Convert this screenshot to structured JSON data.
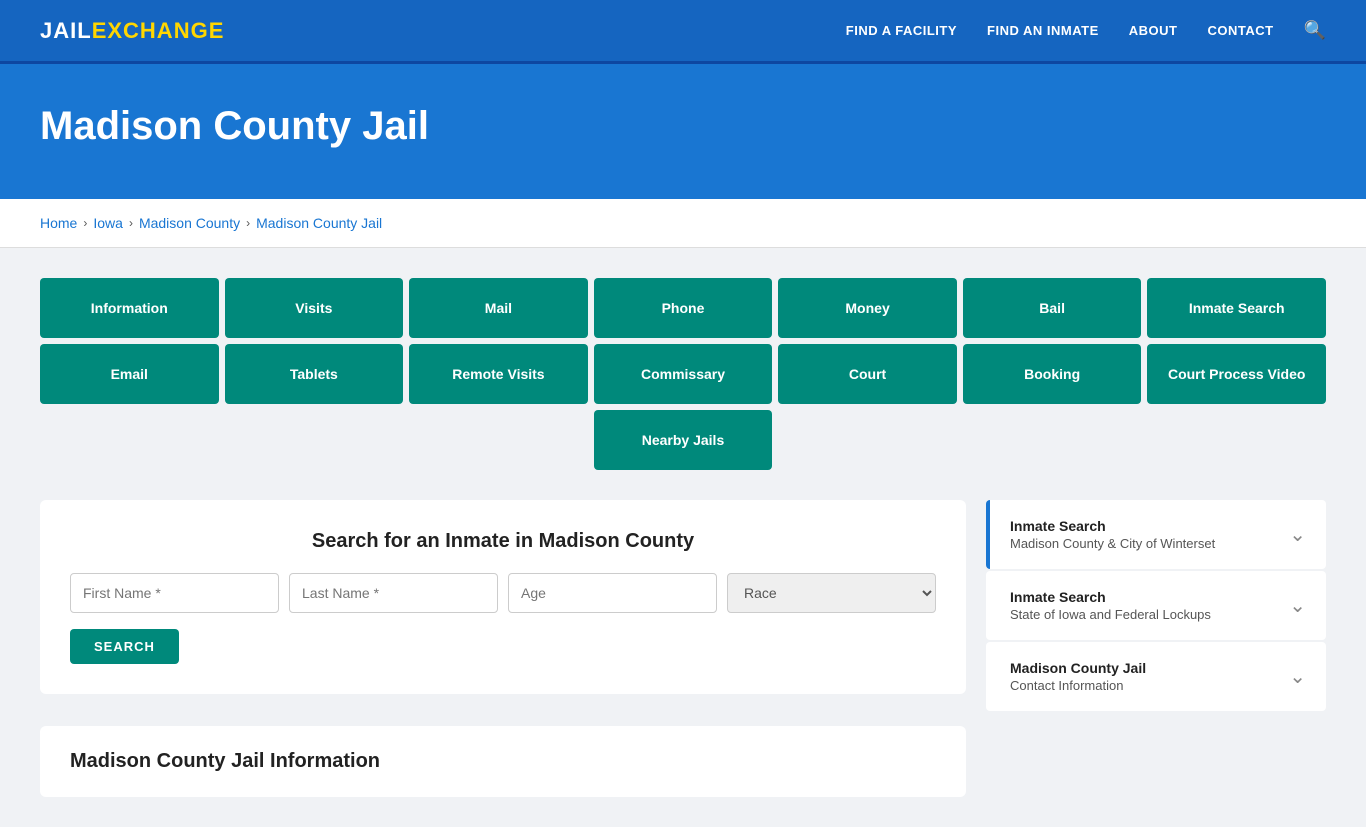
{
  "header": {
    "logo_jail": "JAIL",
    "logo_exchange": "EXCHANGE",
    "nav": [
      {
        "label": "FIND A FACILITY"
      },
      {
        "label": "FIND AN INMATE"
      },
      {
        "label": "ABOUT"
      },
      {
        "label": "CONTACT"
      }
    ]
  },
  "hero": {
    "title": "Madison County Jail"
  },
  "breadcrumb": {
    "items": [
      "Home",
      "Iowa",
      "Madison County",
      "Madison County Jail"
    ]
  },
  "tiles_row1": [
    {
      "label": "Information"
    },
    {
      "label": "Visits"
    },
    {
      "label": "Mail"
    },
    {
      "label": "Phone"
    },
    {
      "label": "Money"
    },
    {
      "label": "Bail"
    },
    {
      "label": "Inmate Search"
    }
  ],
  "tiles_row2": [
    {
      "label": "Email"
    },
    {
      "label": "Tablets"
    },
    {
      "label": "Remote Visits"
    },
    {
      "label": "Commissary"
    },
    {
      "label": "Court"
    },
    {
      "label": "Booking"
    },
    {
      "label": "Court Process Video"
    }
  ],
  "tiles_row3": [
    {
      "label": "Nearby Jails"
    }
  ],
  "search": {
    "title": "Search for an Inmate in Madison County",
    "first_name_placeholder": "First Name *",
    "last_name_placeholder": "Last Name *",
    "age_placeholder": "Age",
    "race_placeholder": "Race",
    "button_label": "SEARCH"
  },
  "info_section": {
    "title": "Madison County Jail Information"
  },
  "sidebar": {
    "cards": [
      {
        "title": "Inmate Search",
        "sub": "Madison County & City of Winterset",
        "active": true
      },
      {
        "title": "Inmate Search",
        "sub": "State of Iowa and Federal Lockups",
        "active": false
      },
      {
        "title": "Madison County Jail",
        "sub": "Contact Information",
        "active": false
      }
    ]
  }
}
